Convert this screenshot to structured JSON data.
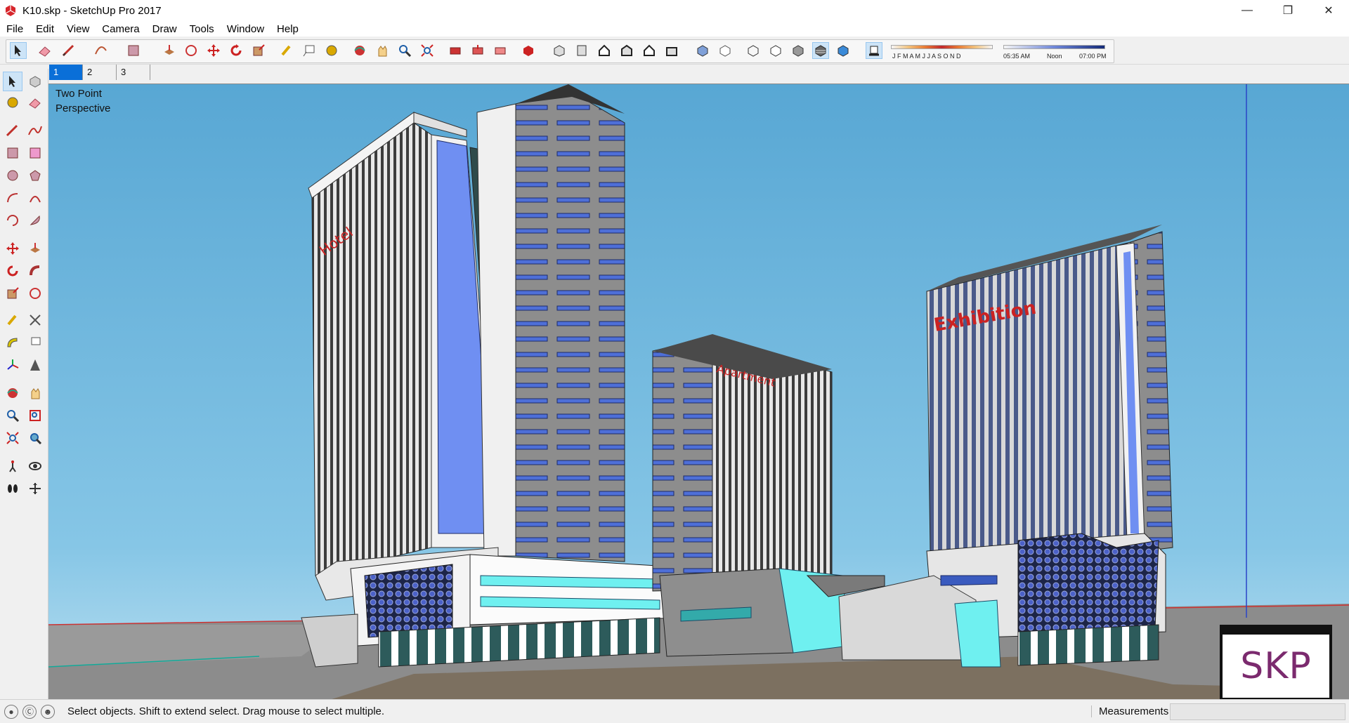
{
  "window": {
    "title": "K10.skp - SketchUp Pro 2017",
    "controls": [
      "minimize-icon",
      "restore-icon",
      "close-icon"
    ]
  },
  "menu": {
    "items": [
      "File",
      "Edit",
      "View",
      "Camera",
      "Draw",
      "Tools",
      "Window",
      "Help"
    ]
  },
  "shadows": {
    "months": "J F M A M J J A S O N D",
    "time_start": "05:35 AM",
    "time_mid": "Noon",
    "time_end": "07:00 PM"
  },
  "scenes": {
    "tabs": [
      "1",
      "2",
      "3"
    ],
    "active": "1"
  },
  "viewport": {
    "camera_label_line1": "Two Point",
    "camera_label_line2": "Perspective",
    "logo_text": "SKP",
    "sign_left": "Hotel",
    "sign_center": "Apartment",
    "sign_right": "Exhibition",
    "sky_color": "#5aaed6",
    "accent_blue": "#6f8ff2"
  },
  "status": {
    "hint": "Select objects. Shift to extend select. Drag mouse to select multiple.",
    "measurements_label": "Measurements",
    "measurements_value": ""
  }
}
